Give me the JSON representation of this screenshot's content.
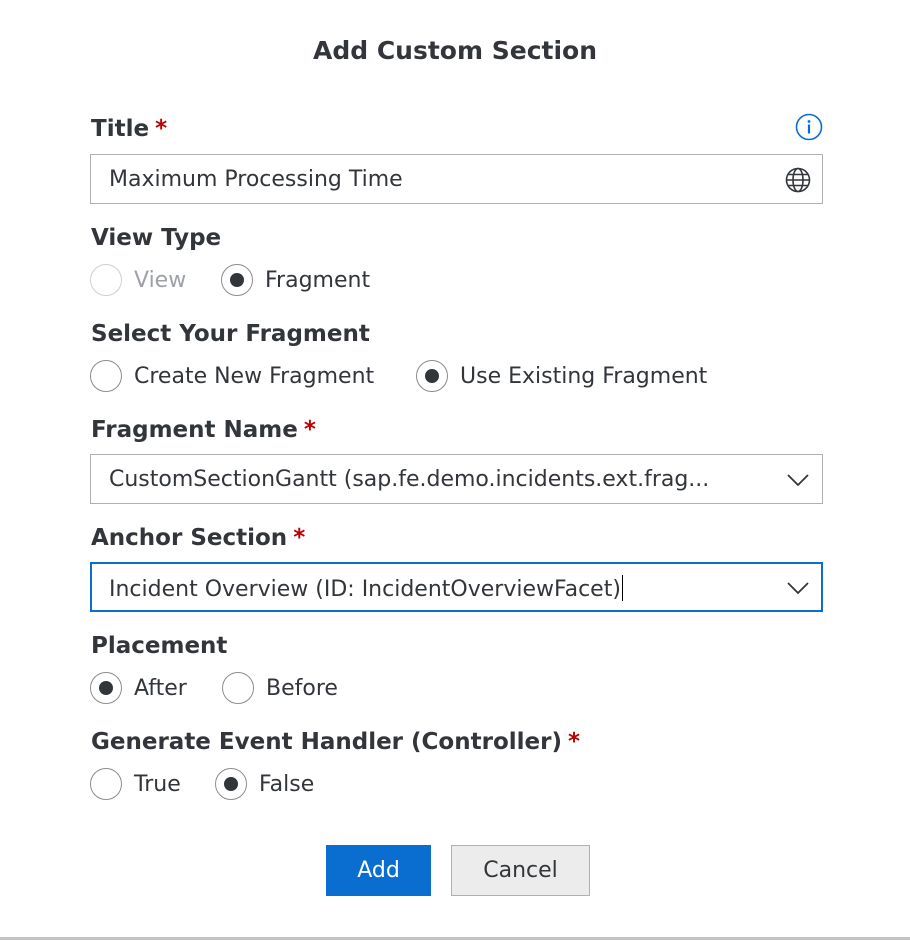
{
  "dialog": {
    "title": "Add Custom Section",
    "add_label": "Add",
    "cancel_label": "Cancel"
  },
  "title_field": {
    "label": "Title",
    "required_mark": "*",
    "value": "Maximum Processing Time",
    "info_icon": "info-icon",
    "translate_icon": "globe-icon"
  },
  "view_type": {
    "label": "View Type",
    "options": [
      {
        "label": "View",
        "checked": false,
        "disabled": true
      },
      {
        "label": "Fragment",
        "checked": true,
        "disabled": false
      }
    ]
  },
  "select_fragment": {
    "label": "Select Your Fragment",
    "options": [
      {
        "label": "Create New Fragment",
        "checked": false
      },
      {
        "label": "Use Existing Fragment",
        "checked": true
      }
    ]
  },
  "fragment_name": {
    "label": "Fragment Name",
    "required_mark": "*",
    "value": "CustomSectionGantt (sap.fe.demo.incidents.ext.frag...",
    "dropdown_icon": "chevron-down-icon"
  },
  "anchor_section": {
    "label": "Anchor Section",
    "required_mark": "*",
    "value": "Incident Overview (ID: IncidentOverviewFacet)",
    "dropdown_icon": "chevron-down-icon"
  },
  "placement": {
    "label": "Placement",
    "options": [
      {
        "label": "After",
        "checked": true
      },
      {
        "label": "Before",
        "checked": false
      }
    ]
  },
  "event_handler": {
    "label": "Generate Event Handler (Controller)",
    "required_mark": "*",
    "options": [
      {
        "label": "True",
        "checked": false
      },
      {
        "label": "False",
        "checked": true
      }
    ]
  },
  "colors": {
    "accent": "#0a6ed1",
    "required": "#bb0000",
    "text": "#32363a"
  }
}
